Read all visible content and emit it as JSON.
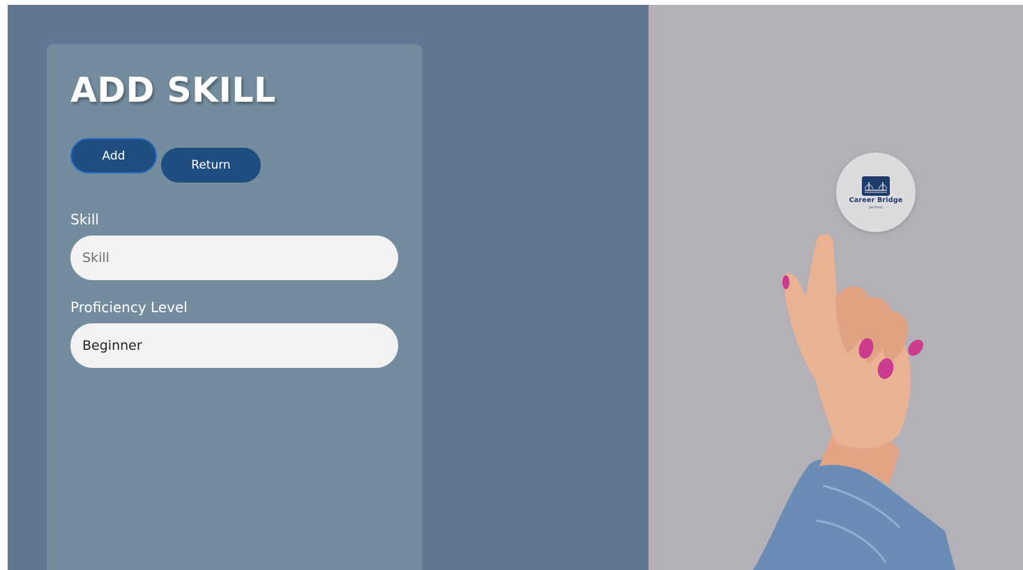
{
  "form": {
    "title": "ADD SKILL",
    "add_label": "Add",
    "return_label": "Return",
    "skill_label": "Skill",
    "skill_placeholder": "Skill",
    "skill_value": "",
    "proficiency_label": "Proficiency Level",
    "proficiency_value": "Beginner"
  },
  "brand": {
    "name": "Career Bridge",
    "tagline": "Job Portal"
  },
  "colors": {
    "left_background": "#627793",
    "card_background": "#738d9f",
    "button": "#1e4d80",
    "right_background": "#b3b0b7"
  },
  "icons": {
    "badge_logo": "bridge-icon"
  }
}
